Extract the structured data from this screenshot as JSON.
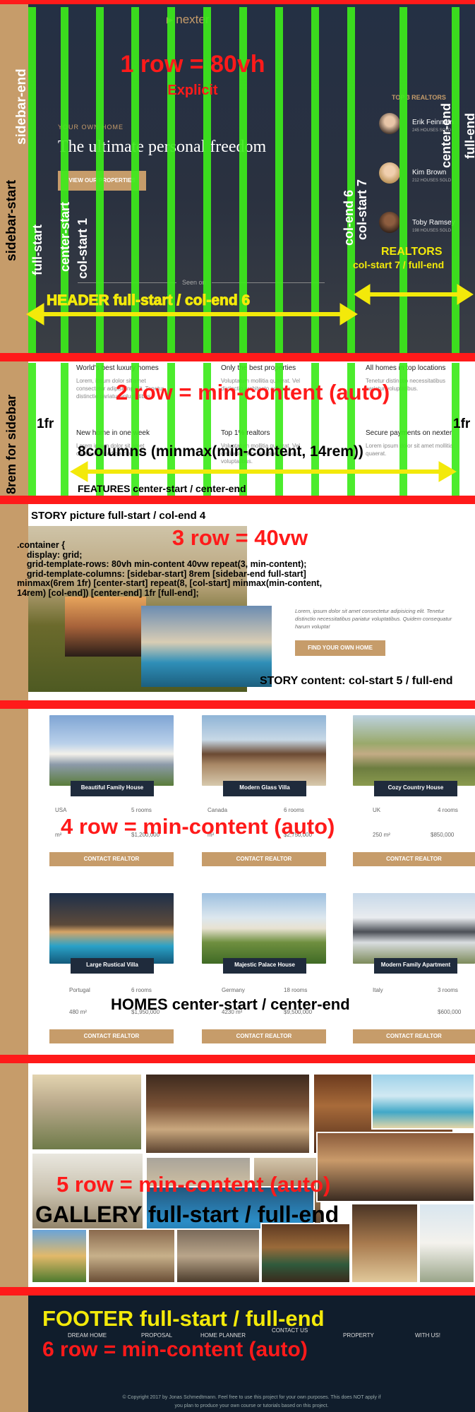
{
  "header": {
    "logo": "nexter",
    "row_label": "1 row = 80vh",
    "row_sub": "Explicit",
    "eyebrow": "YOUR OWN HOME",
    "headline": "The ultimate personal freedom",
    "cta": "VIEW OUR PROPERTIES",
    "seen_on": "Seen on",
    "area_label": "HEADER full-start / col-end 6"
  },
  "realtors": {
    "title": "TOP 3 REALTORS",
    "people": [
      {
        "name": "Erik Feinman",
        "houses": "245 HOUSES SOLD"
      },
      {
        "name": "Kim Brown",
        "houses": "212 HOUSES SOLD"
      },
      {
        "name": "Toby Ramsey",
        "houses": "198 HOUSES SOLD"
      }
    ],
    "label": "REALTORS",
    "area": "col-start 7 / full-end"
  },
  "lines": {
    "sidebar_start": "sidebar-start",
    "sidebar_end": "sidebar-end",
    "full_start": "full-start",
    "center_start": "center-start",
    "col_start_1": "col-start 1",
    "col_end_6": "col-end 6",
    "col_start_7": "col-start 7",
    "center_end": "center-end",
    "full_end": "full-end"
  },
  "features": {
    "row_label": "2 row = min-content (auto)",
    "fr_left": "1fr",
    "fr_right": "1fr",
    "sidebar_note": "8rem for sidebar",
    "columns_note": "8columns (minmax(min-content, 14rem))",
    "area": "FEATURES center-start / center-end",
    "items": [
      {
        "title": "World's best luxury homes",
        "text": "Lorem, ipsum dolor sit amet consectetur adipisicing elit. Tenetur distinctio pariatur voluptatibus."
      },
      {
        "title": "Only the best properties",
        "text": "Voluptatum mollitia quaerat. Vel distinctio architecto aut quia."
      },
      {
        "title": "All homes in top locations",
        "text": "Tenetur distinctio necessitatibus pariatur voluptatibus."
      },
      {
        "title": "New home in one week",
        "text": "Lorem ipsum dolor sit amet consectetur adipisicing elit."
      },
      {
        "title": "Top 1% realtors",
        "text": "Voluptatum mollitia quaerat. Vel distinctio necessitatibus pariatur voluptatibus."
      },
      {
        "title": "Secure payments on nexter",
        "text": "Lorem ipsum dolor sit amet mollitia quaerat."
      }
    ]
  },
  "story": {
    "picture_label": "STORY picture full-start / col-end 4",
    "row_label": "3 row = 40vw",
    "code": [
      ".container {",
      "    display: grid;",
      "    grid-template-rows: 80vh min-content 40vw repeat(3, min-content);",
      "    grid-template-columns: [sidebar-start] 8rem [sidebar-end full-start]",
      "minmax(6rem 1fr) [center-start] repeat(8, [col-start] minmax(min-content,",
      "14rem) [col-end]) [center-end] 1fr [full-end];"
    ],
    "text": "Lorem, ipsum dolor sit amet consectetur adipisicing elit. Tenetur distinctio necessitatibus pariatur voluptatibus. Quidem consequatur harum volupta!",
    "button": "FIND YOUR OWN HOME",
    "content_label": "STORY content: col-start 5 / full-end"
  },
  "homes": {
    "row_label": "4 row = min-content (auto)",
    "area": "HOMES center-start / center-end",
    "contact": "CONTACT REALTOR",
    "items": [
      {
        "name": "Beautiful Family House",
        "country": "USA",
        "rooms": "5 rooms",
        "area": "m²",
        "price": "$1,200,000"
      },
      {
        "name": "Modern Glass Villa",
        "country": "Canada",
        "rooms": "6 rooms",
        "area": "m²",
        "price": "$2,750,000"
      },
      {
        "name": "Cozy Country House",
        "country": "UK",
        "rooms": "4 rooms",
        "area": "250 m²",
        "price": "$850,000"
      },
      {
        "name": "Large Rustical Villa",
        "country": "Portugal",
        "rooms": "6 rooms",
        "area": "480 m²",
        "price": "$1,950,000"
      },
      {
        "name": "Majestic Palace House",
        "country": "Germany",
        "rooms": "18 rooms",
        "area": "4230 m²",
        "price": "$9,500,000"
      },
      {
        "name": "Modern Family Apartment",
        "country": "Italy",
        "rooms": "3 rooms",
        "area": "",
        "price": "$600,000"
      }
    ]
  },
  "gallery": {
    "row_label": "5 row = min-content (auto)",
    "area": "GALLERY full-start / full-end"
  },
  "footer": {
    "area": "FOOTER full-start / full-end",
    "row_label": "6 row = min-content (auto)",
    "links": [
      "DREAM HOME",
      "PROPOSAL",
      "HOME PLANNER",
      "CONTACT US",
      "PROPERTY",
      "WITH US!"
    ],
    "copyright_1": "© Copyright 2017 by Jonas Schmedtmann. Feel free to use this project for your own purposes. This does NOT apply if",
    "copyright_2": "you plan to produce your own course or tutorials based on this project."
  },
  "colors": {
    "grid_line": "#3dea1b",
    "row_divider": "#ff1a1a",
    "sidebar": "#c69c6a",
    "header_bg": "#243044",
    "footer_bg": "#101d2c"
  }
}
